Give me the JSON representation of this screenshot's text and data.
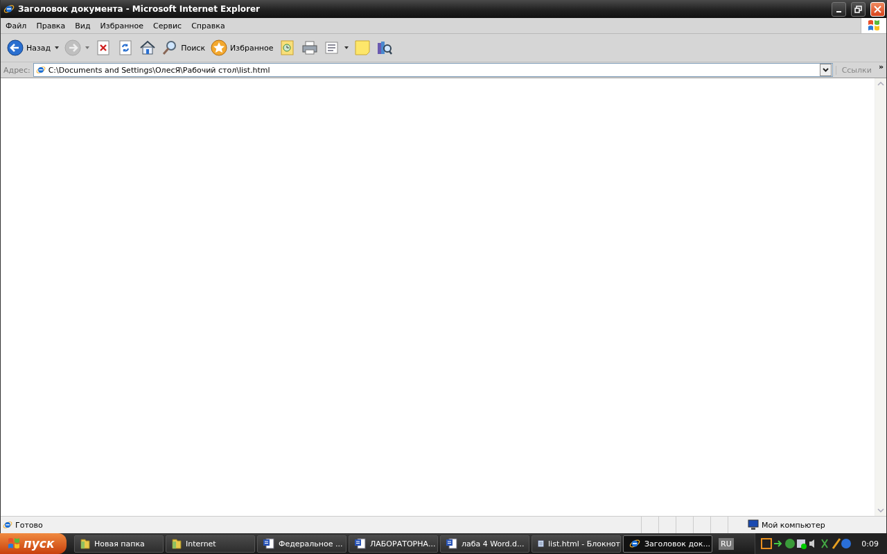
{
  "window": {
    "title": "Заголовок документа - Microsoft Internet Explorer"
  },
  "menu": [
    "Файл",
    "Правка",
    "Вид",
    "Избранное",
    "Сервис",
    "Справка"
  ],
  "toolbar": [
    {
      "kind": "back",
      "label": "Назад",
      "disabled": false,
      "dropdown": true
    },
    {
      "kind": "forward",
      "disabled": true,
      "dropdown": true
    },
    {
      "kind": "stop",
      "disabled": false,
      "dropdown": false
    },
    {
      "kind": "refresh",
      "disabled": false,
      "dropdown": false
    },
    {
      "kind": "home",
      "disabled": false,
      "dropdown": false
    },
    {
      "kind": "search",
      "label": "Поиск",
      "disabled": false,
      "dropdown": false
    },
    {
      "kind": "favorites",
      "label": "Избранное",
      "disabled": false,
      "dropdown": false
    },
    {
      "kind": "history",
      "disabled": false,
      "dropdown": false
    },
    {
      "kind": "print",
      "disabled": false,
      "dropdown": false
    },
    {
      "kind": "edit",
      "disabled": false,
      "dropdown": true
    },
    {
      "kind": "note",
      "disabled": false,
      "dropdown": false
    },
    {
      "kind": "research",
      "disabled": false,
      "dropdown": false
    }
  ],
  "address": {
    "label": "Адрес:",
    "value": "C:\\Documents and Settings\\ОлесЯ\\Рабочий стол\\list.html",
    "links": "Ссылки",
    "chevron": "»"
  },
  "status_bar": {
    "text": "Готово",
    "zone": "Мой компьютер"
  },
  "taskbar": {
    "start": "пуск",
    "tasks": [
      {
        "kind": "folder",
        "label": "Новая папка",
        "selected": false
      },
      {
        "kind": "folder",
        "label": "Internet",
        "selected": false
      },
      {
        "kind": "word",
        "label": "Федеральное ...",
        "selected": false
      },
      {
        "kind": "word",
        "label": "ЛАБОРАТОРНА...",
        "selected": false
      },
      {
        "kind": "word",
        "label": "лаба 4 Word.d...",
        "selected": false
      },
      {
        "kind": "notepad",
        "label": "list.html - Блокнот",
        "selected": false
      },
      {
        "kind": "ie",
        "label": "Заголовок док...",
        "selected": true
      }
    ],
    "language": "RU",
    "clock": "0:09"
  }
}
